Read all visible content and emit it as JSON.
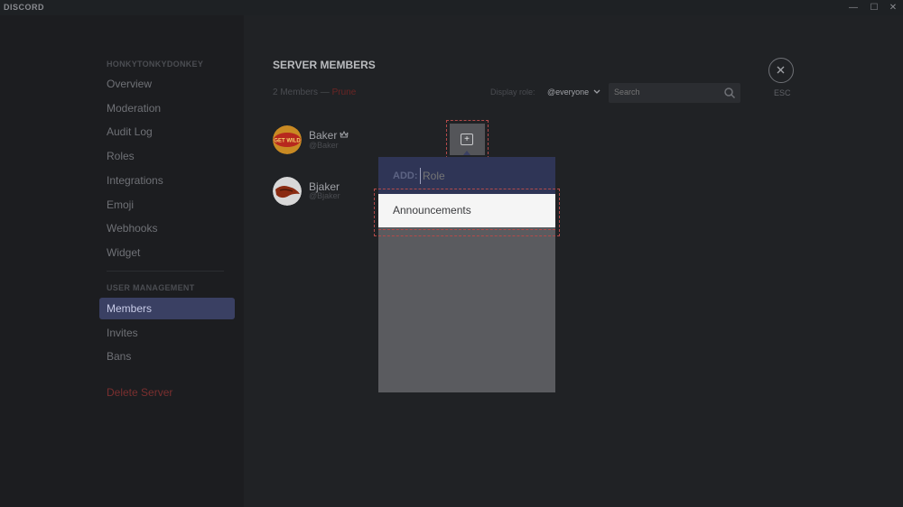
{
  "app": {
    "brand": "DISCORD"
  },
  "window_controls": {
    "minimize": "—",
    "maximize": "☐",
    "close": "✕"
  },
  "sidebar": {
    "server_header": "HONKYTONKYDONKEY",
    "items": [
      {
        "label": "Overview"
      },
      {
        "label": "Moderation"
      },
      {
        "label": "Audit Log"
      },
      {
        "label": "Roles"
      },
      {
        "label": "Integrations"
      },
      {
        "label": "Emoji"
      },
      {
        "label": "Webhooks"
      },
      {
        "label": "Widget"
      }
    ],
    "user_management_header": "USER MANAGEMENT",
    "user_items": [
      {
        "label": "Members",
        "active": true
      },
      {
        "label": "Invites"
      },
      {
        "label": "Bans"
      }
    ],
    "delete_label": "Delete Server"
  },
  "main": {
    "title": "SERVER MEMBERS",
    "member_count": "2 Members — ",
    "prune_label": "Prune",
    "display_role_label": "Display role:",
    "display_role_value": "@everyone",
    "search_placeholder": "Search",
    "esc_label": "ESC"
  },
  "members": [
    {
      "name": "Baker",
      "tag": "Baker",
      "owner": true
    },
    {
      "name": "Bjaker",
      "tag": "Bjaker",
      "owner": false
    }
  ],
  "avatar_text": {
    "baker": "GET WILD"
  },
  "role_popup": {
    "add_label": "ADD:",
    "input_placeholder": "Role",
    "options": [
      {
        "label": "Announcements"
      }
    ],
    "plus_symbol": "+"
  },
  "colors": {
    "accent": "#3a4063",
    "danger": "#7a2f2f",
    "popup_header": "#2f3556"
  }
}
